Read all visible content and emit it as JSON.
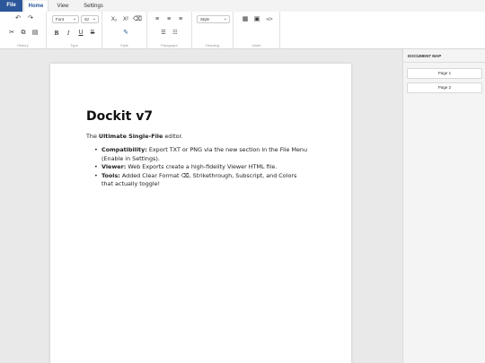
{
  "menu": {
    "tabs": [
      {
        "label": "File"
      },
      {
        "label": "Home"
      },
      {
        "label": "View"
      },
      {
        "label": "Settings"
      }
    ]
  },
  "ribbon": {
    "groups": {
      "history": "History",
      "type": "Type",
      "style": "Style",
      "paragraph": "Paragraph",
      "heading": "Heading",
      "insert": "Insert"
    },
    "font_select": "Font",
    "size_select": "Sz",
    "style_select": "Style",
    "buttons": {
      "undo": "↶",
      "redo": "↷",
      "cut": "✂",
      "copy": "⧉",
      "paste": "▤",
      "bold": "B",
      "italic": "I",
      "underline": "U",
      "strike": "S",
      "subscript": "X₂",
      "superscript": "X²",
      "clear_format": "⌫",
      "pen": "✎",
      "align_left": "≡",
      "align_center": "≡",
      "align_right": "≡",
      "bullets": "☰",
      "numbers": "☷",
      "table": "▦",
      "image": "▣",
      "code": "</>"
    },
    "icon_names": [
      "undo-icon",
      "redo-icon",
      "scissors-icon",
      "copy-icon",
      "paste-icon"
    ]
  },
  "document": {
    "title": "Dockit v7",
    "intro_prefix": "The ",
    "intro_bold": "Ultimate Single-File",
    "intro_suffix": " editor.",
    "items": [
      {
        "label": "Compatibility:",
        "text": " Export TXT or PNG via the new section in the File Menu (Enable in Settings)."
      },
      {
        "label": "Viewer:",
        "text": " Web Exports create a high-fidelity Viewer HTML file."
      },
      {
        "label": "Tools:",
        "text": " Added Clear Format ⌫, Strikethrough, Subscript, and Colors that actually toggle!"
      }
    ]
  },
  "docmap": {
    "title": "DOCUMENT MAP",
    "pages": [
      "Page 1",
      "Page 2"
    ]
  }
}
